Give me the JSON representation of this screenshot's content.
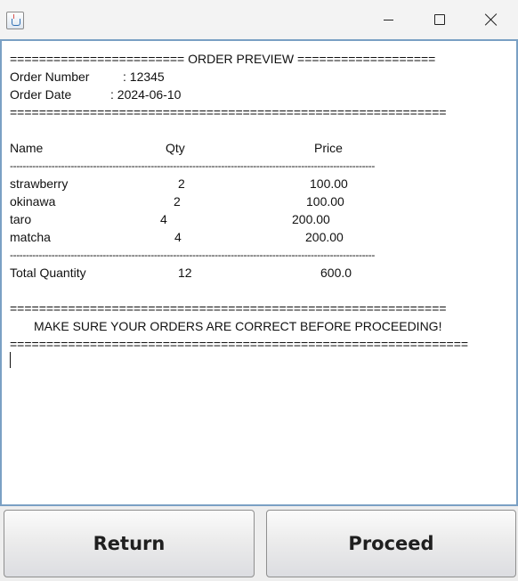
{
  "window": {
    "icon": "java-cup-icon",
    "controls": [
      "minimize-icon",
      "maximize-icon",
      "close-icon"
    ]
  },
  "receipt": {
    "top_rule": "======================== ORDER PREVIEW ===================",
    "order_number_label": "Order Number",
    "order_number_value": ": 12345",
    "order_date_label": "Order Date",
    "order_date_value": ": 2024-06-10",
    "rule_double": "============================================================",
    "headers": {
      "name": "Name",
      "qty": "Qty",
      "price": "Price"
    },
    "rule_dash": "------------------------------------------------------------------------------------------------------------------",
    "items": [
      {
        "name": "strawberry",
        "qty": "2",
        "price": "100.00"
      },
      {
        "name": "okinawa",
        "qty": "2",
        "price": "100.00"
      },
      {
        "name": "taro",
        "qty": "4",
        "price": "200.00"
      },
      {
        "name": "matcha",
        "qty": "4",
        "price": "200.00"
      }
    ],
    "total_label": "Total Quantity",
    "total_qty": "12",
    "total_price": "600.0",
    "warning": "MAKE SURE YOUR ORDERS ARE CORRECT BEFORE PROCEEDING!",
    "rule_double_long": "==============================================================="
  },
  "buttons": {
    "return_label": "Return",
    "proceed_label": "Proceed"
  }
}
